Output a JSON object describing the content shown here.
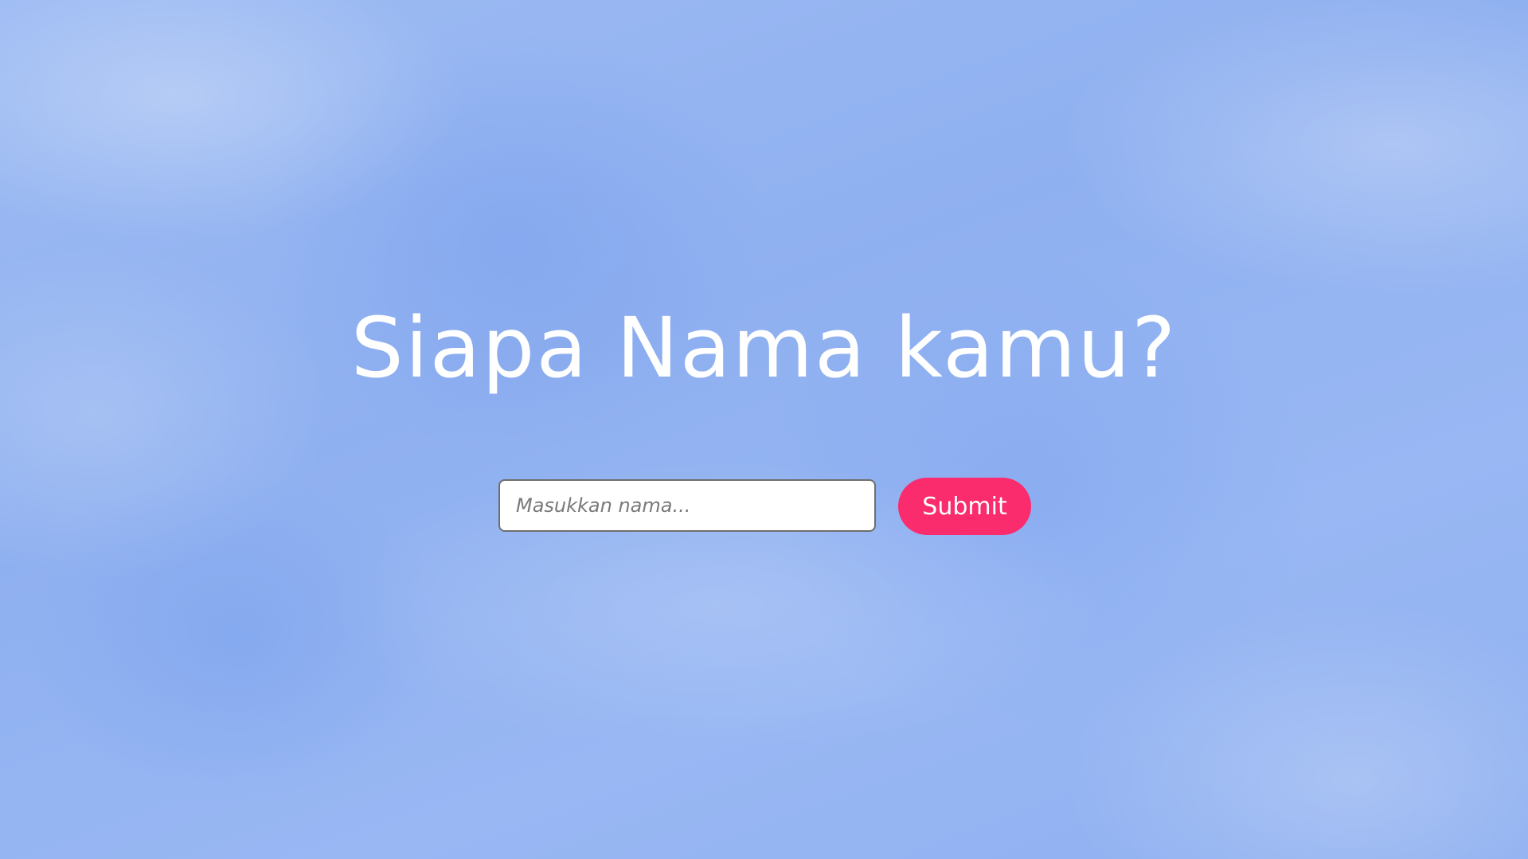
{
  "page": {
    "heading": "Siapa Nama kamu?"
  },
  "form": {
    "name_input": {
      "value": "",
      "placeholder": "Masukkan nama..."
    },
    "submit_label": "Submit"
  },
  "colors": {
    "background_sky": "#93b4f2",
    "heading_text": "#ffffff",
    "submit_button": "#fa2c6e",
    "input_background": "#ffffff"
  }
}
